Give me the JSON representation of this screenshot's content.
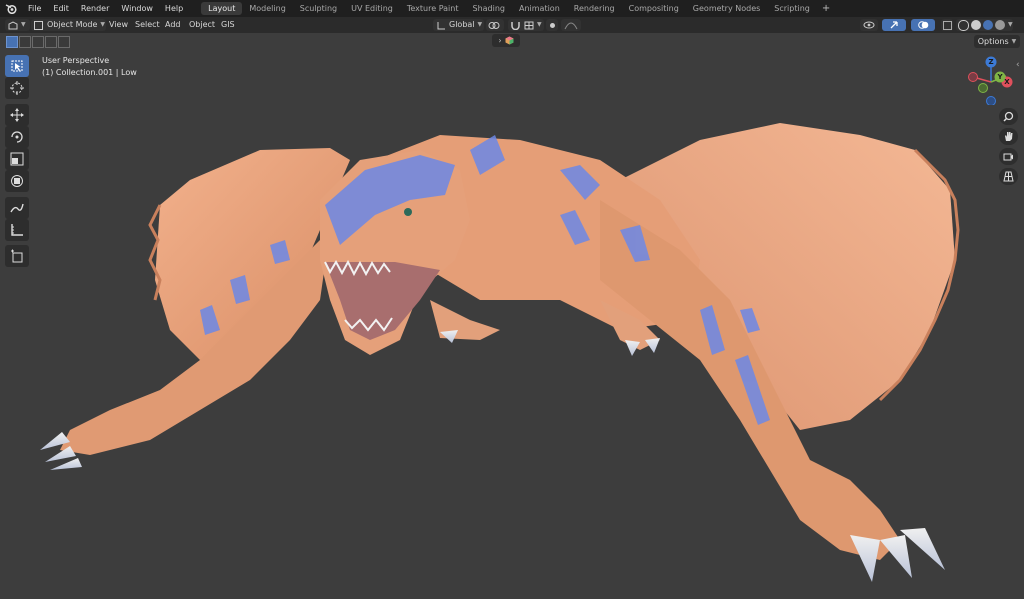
{
  "menu": {
    "items": [
      "File",
      "Edit",
      "Render",
      "Window",
      "Help"
    ]
  },
  "workspaces": {
    "tabs": [
      "Layout",
      "Modeling",
      "Sculpting",
      "UV Editing",
      "Texture Paint",
      "Shading",
      "Animation",
      "Rendering",
      "Compositing",
      "Geometry Nodes",
      "Scripting"
    ],
    "active": "Layout",
    "add_symbol": "+"
  },
  "header": {
    "mode": "Object Mode",
    "menus": [
      "View",
      "Select",
      "Add",
      "Object",
      "GIS"
    ],
    "transform_orientation": "Global",
    "options_label": "Options"
  },
  "viewport": {
    "view_name": "User Perspective",
    "collection_info": "(1) Collection.001 | Low"
  },
  "gizmo": {
    "x_label": "X",
    "y_label": "Y",
    "z_label": "Z",
    "colors": {
      "x": "#e0505c",
      "y": "#7fb545",
      "z": "#3c7ad6"
    }
  },
  "theme": {
    "accent": "#4772b3",
    "model_skin": "#e9a37a",
    "model_stripes": "#6d88e6"
  }
}
